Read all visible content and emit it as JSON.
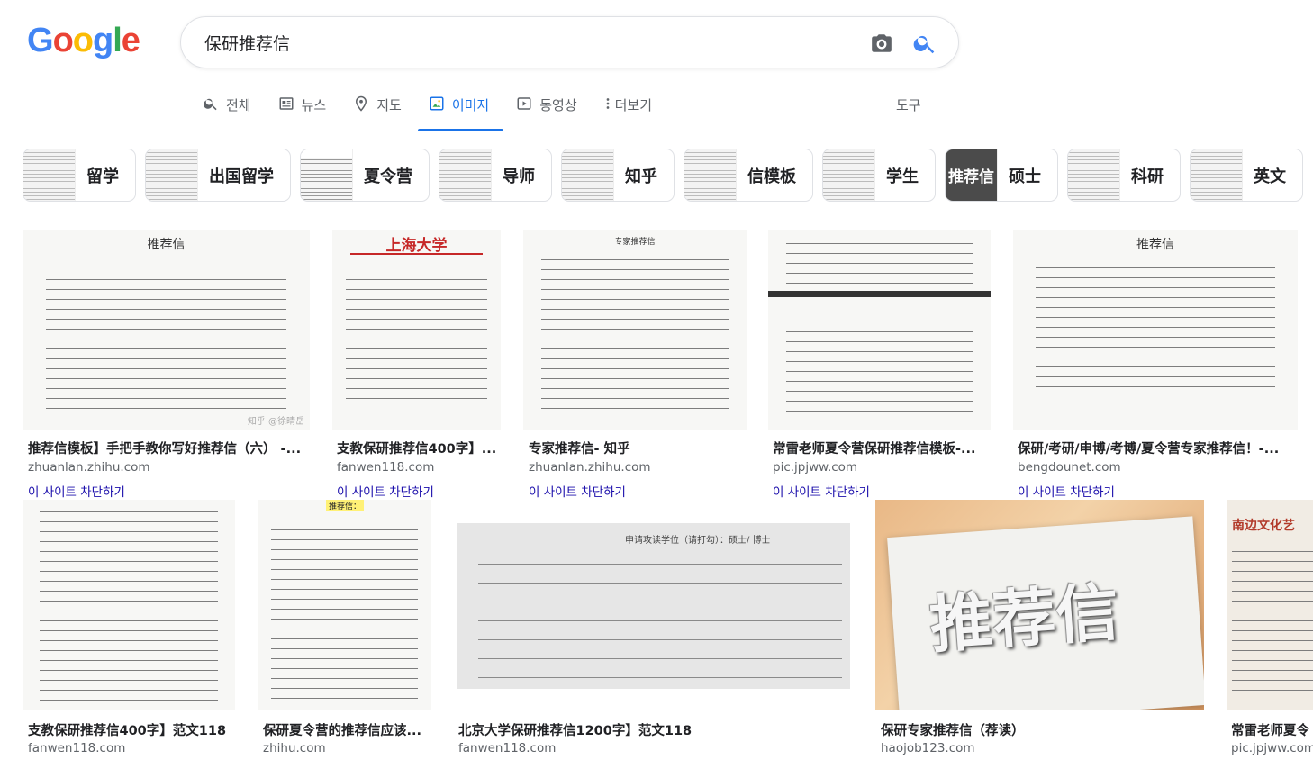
{
  "logo": {
    "letters": [
      "G",
      "o",
      "o",
      "g",
      "l",
      "e"
    ],
    "colors": [
      "#4285F4",
      "#EA4335",
      "#FBBC05",
      "#4285F4",
      "#34A853",
      "#EA4335"
    ]
  },
  "search": {
    "value": "保研推荐信"
  },
  "tabs": [
    {
      "label": "전체",
      "icon": "search-icon"
    },
    {
      "label": "뉴스",
      "icon": "news-icon"
    },
    {
      "label": "지도",
      "icon": "map-pin-icon"
    },
    {
      "label": "이미지",
      "icon": "image-icon"
    },
    {
      "label": "동영상",
      "icon": "video-icon"
    },
    {
      "label": "더보기",
      "icon": "more-vert-icon"
    }
  ],
  "tools_label": "도구",
  "chips": [
    {
      "label": "留学"
    },
    {
      "label": "出国留学"
    },
    {
      "label": "夏令营"
    },
    {
      "label": "导师"
    },
    {
      "label": "知乎"
    },
    {
      "label": "信模板"
    },
    {
      "label": "学生"
    },
    {
      "label": "硕士",
      "thumb_text": "推荐信"
    },
    {
      "label": "科研"
    },
    {
      "label": "英文"
    }
  ],
  "results": [
    {
      "title": "推荐信模板】手把手教你写好推荐信（六） -...",
      "site": "zhuanlan.zhihu.com",
      "block": "이 사이트 차단하기",
      "thumb_text": "推荐信",
      "watermark": "知乎 @徐晴岳"
    },
    {
      "title": "支教保研推荐信400字】...",
      "site": "fanwen118.com",
      "block": "이 사이트 차단하기",
      "thumb_text": "上海大学"
    },
    {
      "title": "专家推荐信- 知乎",
      "site": "zhuanlan.zhihu.com",
      "block": "이 사이트 차단하기",
      "thumb_text": "专家推荐信"
    },
    {
      "title": "常雷老师夏令营保研推荐信模板-...",
      "site": "pic.jpjww.com",
      "block": "이 사이트 차단하기"
    },
    {
      "title": "保研/考研/申博/考博/夏令营专家推荐信！-...",
      "site": "bengdounet.com",
      "block": "이 사이트 차단하기",
      "thumb_text": "推荐信"
    },
    {
      "title": "支教保研推荐信400字】范文118",
      "site": "fanwen118.com"
    },
    {
      "title": "保研夏令营的推荐信应该...",
      "site": "zhihu.com",
      "thumb_text": "推荐信："
    },
    {
      "title": "北京大学保研推荐信1200字】范文118",
      "site": "fanwen118.com",
      "thumb_text": "申请攻读学位（请打勾）：硕士/ 博士"
    },
    {
      "title": "保研专家推荐信（荐读）",
      "site": "haojob123.com",
      "thumb_text": "推荐信"
    },
    {
      "title": "常雷老师夏令",
      "site": "pic.jpjww.com",
      "thumb_text": "南边文化艺"
    }
  ]
}
